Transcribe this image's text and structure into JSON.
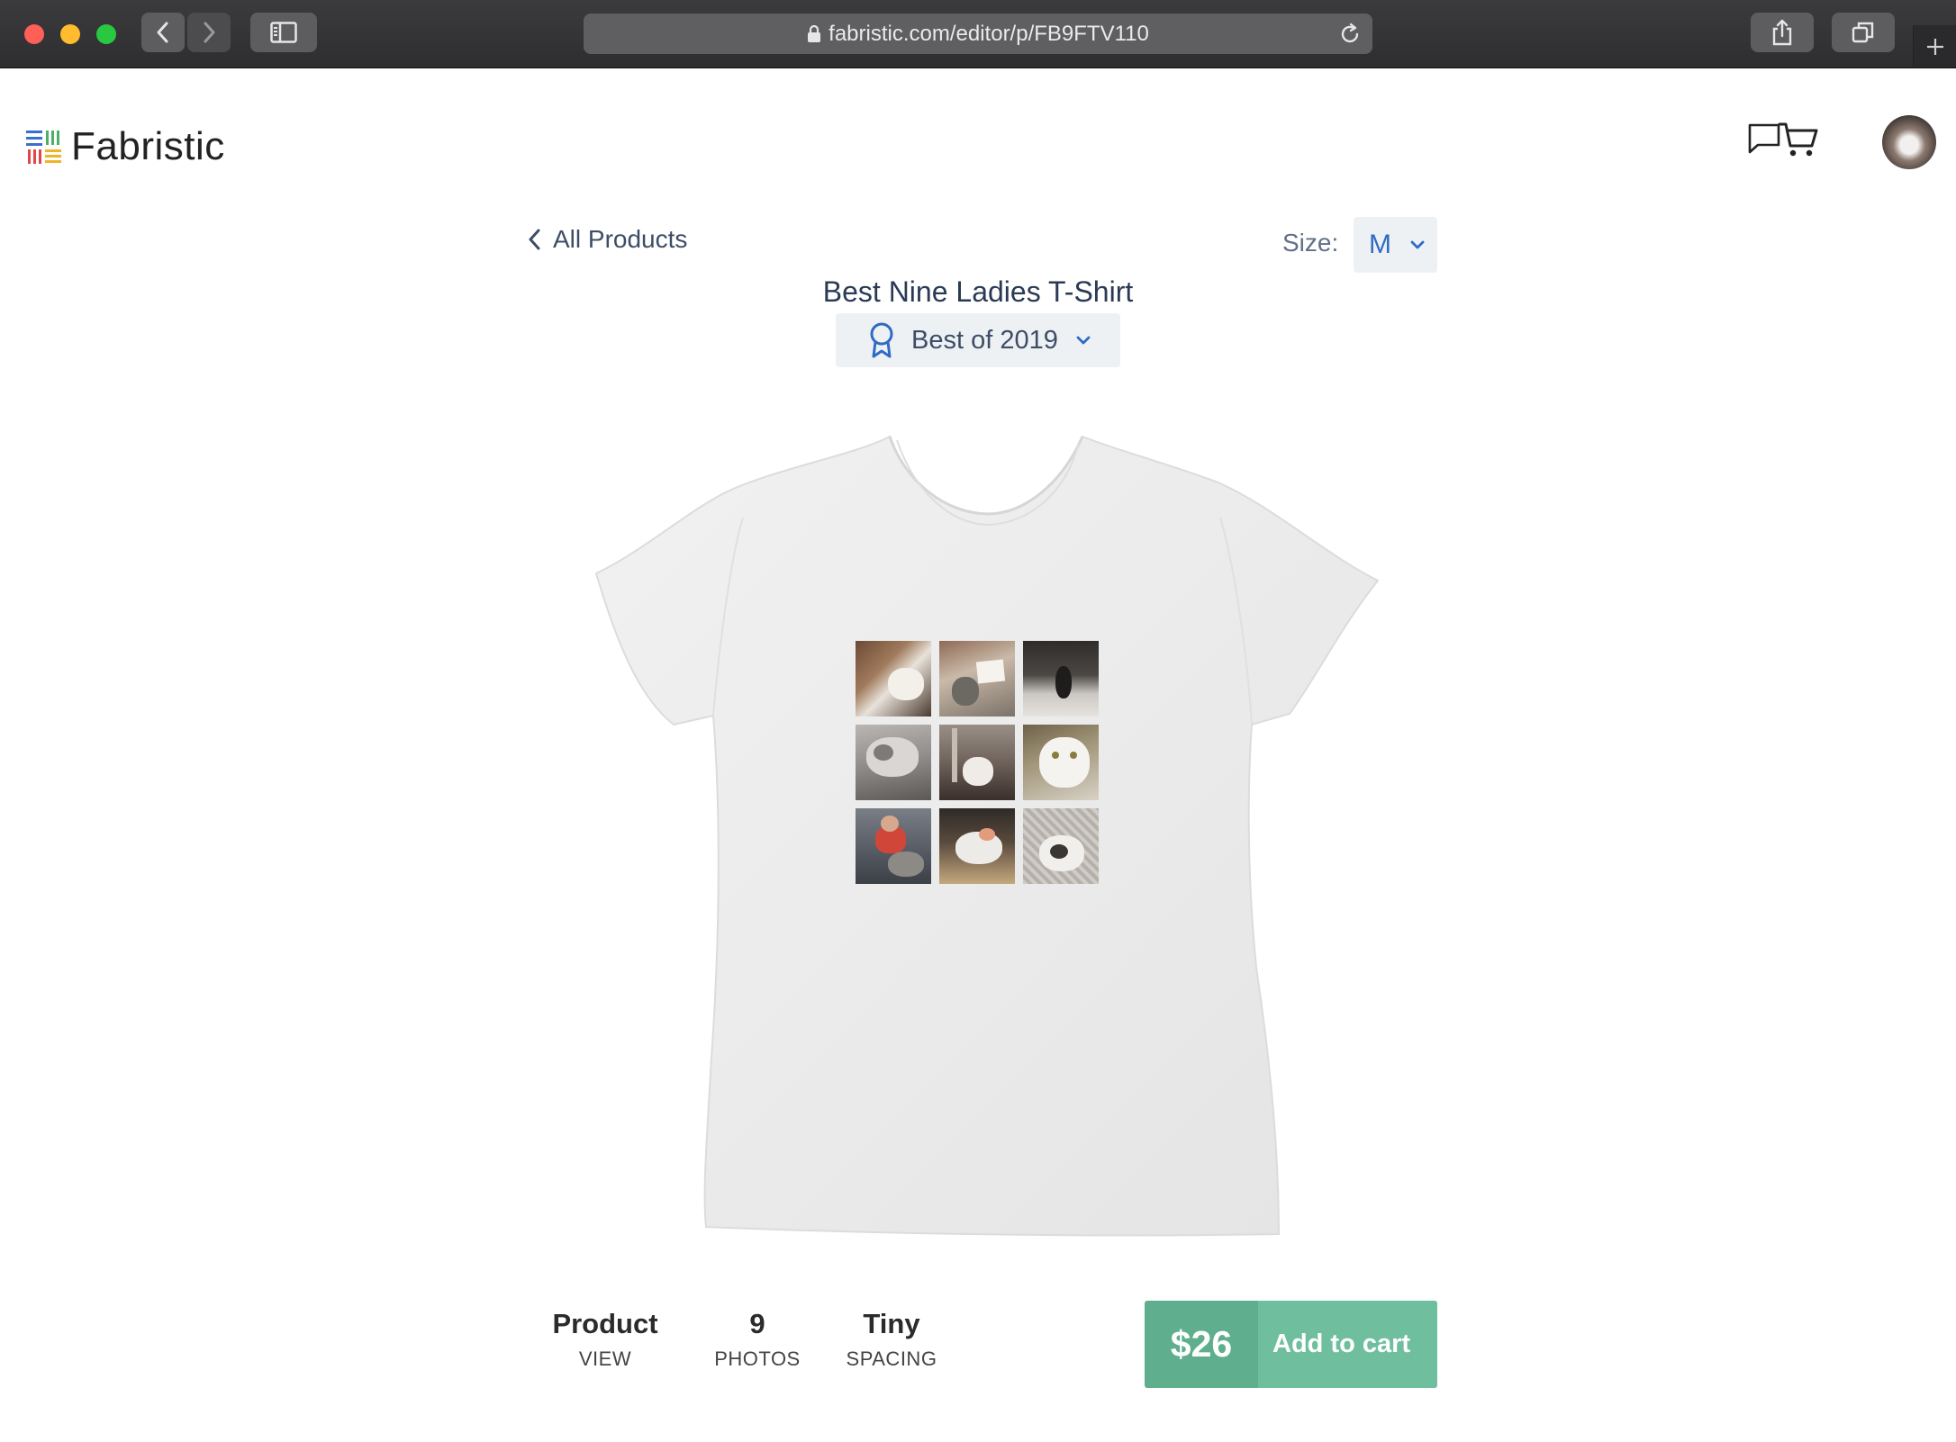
{
  "browser": {
    "url": "fabristic.com/editor/p/FB9FTV110"
  },
  "site": {
    "brand": "Fabristic"
  },
  "editor": {
    "back_label": "All Products",
    "size_label": "Size:",
    "size_value": "M",
    "product_title": "Best Nine Ladies T-Shirt",
    "collection_value": "Best of 2019"
  },
  "stats": [
    {
      "value": "Product",
      "label": "VIEW"
    },
    {
      "value": "9",
      "label": "PHOTOS"
    },
    {
      "value": "Tiny",
      "label": "SPACING"
    }
  ],
  "cart": {
    "price": "$26",
    "label": "Add to cart"
  },
  "colors": {
    "accent_blue": "#2f6bc4",
    "cart_green": "#6fbf9f",
    "cart_green_dark": "#5fae8d"
  }
}
